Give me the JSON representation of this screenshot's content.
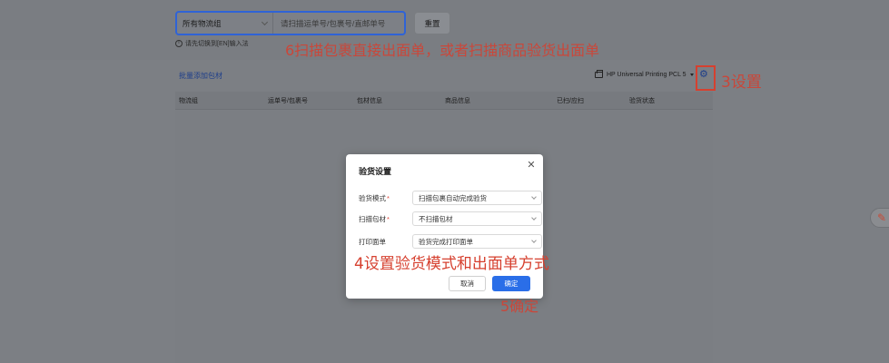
{
  "top": {
    "logistics_select": "所有物流组",
    "scan_placeholder": "请扫描运单号/包裹号/直邮单号",
    "reset_label": "重置",
    "hint": "请先切换到[EN]输入法"
  },
  "toolbar": {
    "bulk_add": "批量添加包材",
    "printer": "HP Universal Printing PCL 5"
  },
  "table": {
    "columns": [
      "物流组",
      "运单号/包裹号",
      "包材信息",
      "商品信息",
      "已扫/应扫",
      "验货状态"
    ]
  },
  "modal": {
    "title": "验货设置",
    "rows": [
      {
        "label": "验货模式",
        "required": "*",
        "value": "扫描包裹自动完成验货"
      },
      {
        "label": "扫描包材",
        "required": "*",
        "value": "不扫描包材"
      },
      {
        "label": "打印面单",
        "required": "",
        "value": "验货完成打印面单"
      }
    ],
    "cancel": "取消",
    "confirm": "确定"
  },
  "annotations": {
    "step6": "6扫描包裹直接出面单，或者扫描商品验货出面单",
    "step3": "3设置",
    "step4": "4设置验货模式和出面单方式",
    "step5": "5确定"
  },
  "colors": {
    "accent": "#2a6ee8",
    "annotation": "#d6402f",
    "overlay": "#7c7f84"
  }
}
